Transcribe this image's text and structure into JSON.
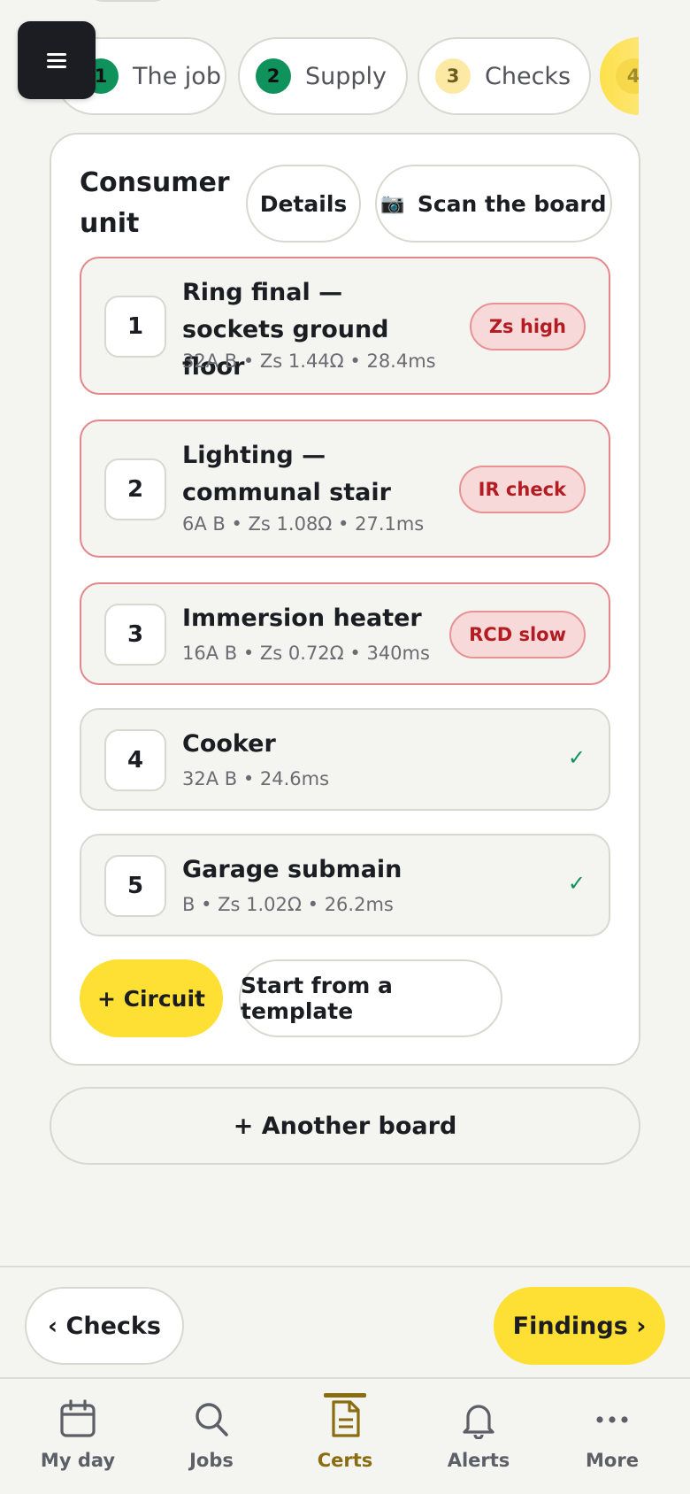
{
  "menu": {
    "icon": "hamburger-menu-icon"
  },
  "steps": [
    {
      "num": "1",
      "label": "The job",
      "status": "done"
    },
    {
      "num": "2",
      "label": "Supply",
      "status": "done"
    },
    {
      "num": "3",
      "label": "Checks",
      "status": "todo"
    },
    {
      "num": "4",
      "label": "",
      "status": "current"
    }
  ],
  "board": {
    "title": "Consumer unit",
    "details_label": "Details",
    "scan_label": "Scan the board",
    "scan_icon": "camera-icon"
  },
  "circuits": [
    {
      "num": "1",
      "name": "Ring final — sockets ground floor",
      "meta": "32A B • Zs 1.44Ω • 28.4ms",
      "badge": "Zs high",
      "status": "warn"
    },
    {
      "num": "2",
      "name": "Lighting — communal stair",
      "meta": "6A B • Zs 1.08Ω • 27.1ms",
      "badge": "IR check",
      "status": "warn"
    },
    {
      "num": "3",
      "name": "Immersion heater",
      "meta": "16A B • Zs 0.72Ω • 340ms",
      "badge": "RCD slow",
      "status": "warn"
    },
    {
      "num": "4",
      "name": "Cooker",
      "meta": "32A B • 24.6ms",
      "badge": "",
      "status": "ok"
    },
    {
      "num": "5",
      "name": "Garage submain",
      "meta": "B • Zs 1.02Ω • 26.2ms",
      "badge": "",
      "status": "ok"
    }
  ],
  "actions": {
    "add_circuit": "+ Circuit",
    "template": "Start from a template",
    "another_board": "+ Another board"
  },
  "footer": {
    "back_label": "‹ Checks",
    "next_label": "Findings ›"
  },
  "tabs": [
    {
      "label": "My day",
      "icon": "calendar-icon"
    },
    {
      "label": "Jobs",
      "icon": "search-icon"
    },
    {
      "label": "Certs",
      "icon": "document-icon",
      "active": true
    },
    {
      "label": "Alerts",
      "icon": "bell-icon"
    },
    {
      "label": "More",
      "icon": "more-dots-icon"
    }
  ],
  "colors": {
    "accent": "#fde033",
    "done": "#10925d",
    "warn": "#b31c22",
    "active_tab": "#8a6d10"
  }
}
